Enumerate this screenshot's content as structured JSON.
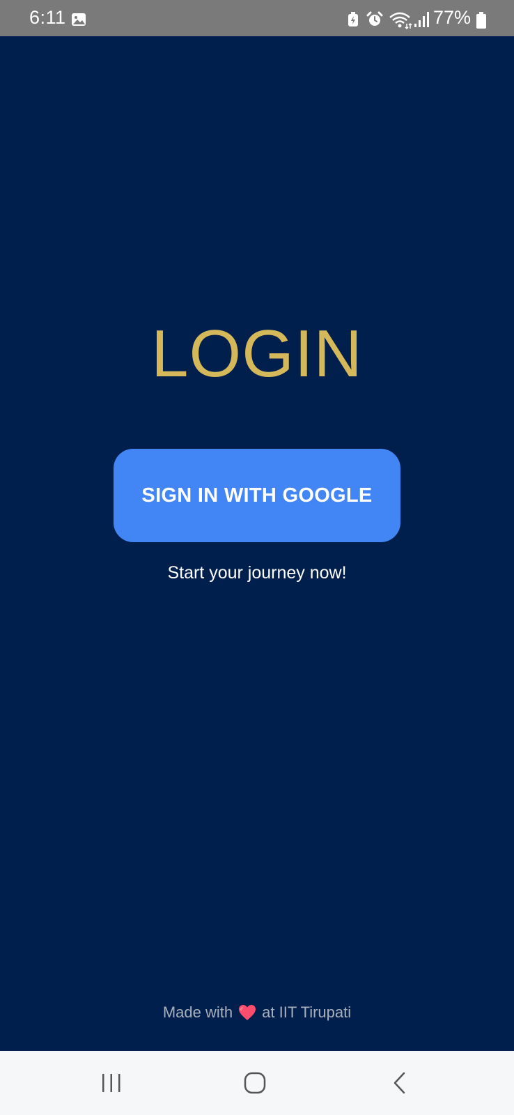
{
  "status_bar": {
    "time": "6:11",
    "battery": "77%",
    "icons": [
      "gallery-icon",
      "battery-saver-icon",
      "alarm-icon",
      "wifi-icon",
      "signal-icon",
      "battery-icon"
    ]
  },
  "main": {
    "title": "LOGIN",
    "google_button_label": "SIGN IN WITH GOOGLE",
    "tagline": "Start your journey now!"
  },
  "footer": {
    "prefix": "Made with",
    "suffix": "at IIT Tirupati",
    "icon": "heart-icon"
  },
  "nav_bar": {
    "buttons": [
      "recent-apps-icon",
      "home-icon",
      "back-icon"
    ]
  },
  "colors": {
    "background": "#001f4d",
    "title": "#d4b85a",
    "button": "#4285f4",
    "status_bar": "#7a7a7a",
    "nav_bar": "#f6f7f9"
  }
}
